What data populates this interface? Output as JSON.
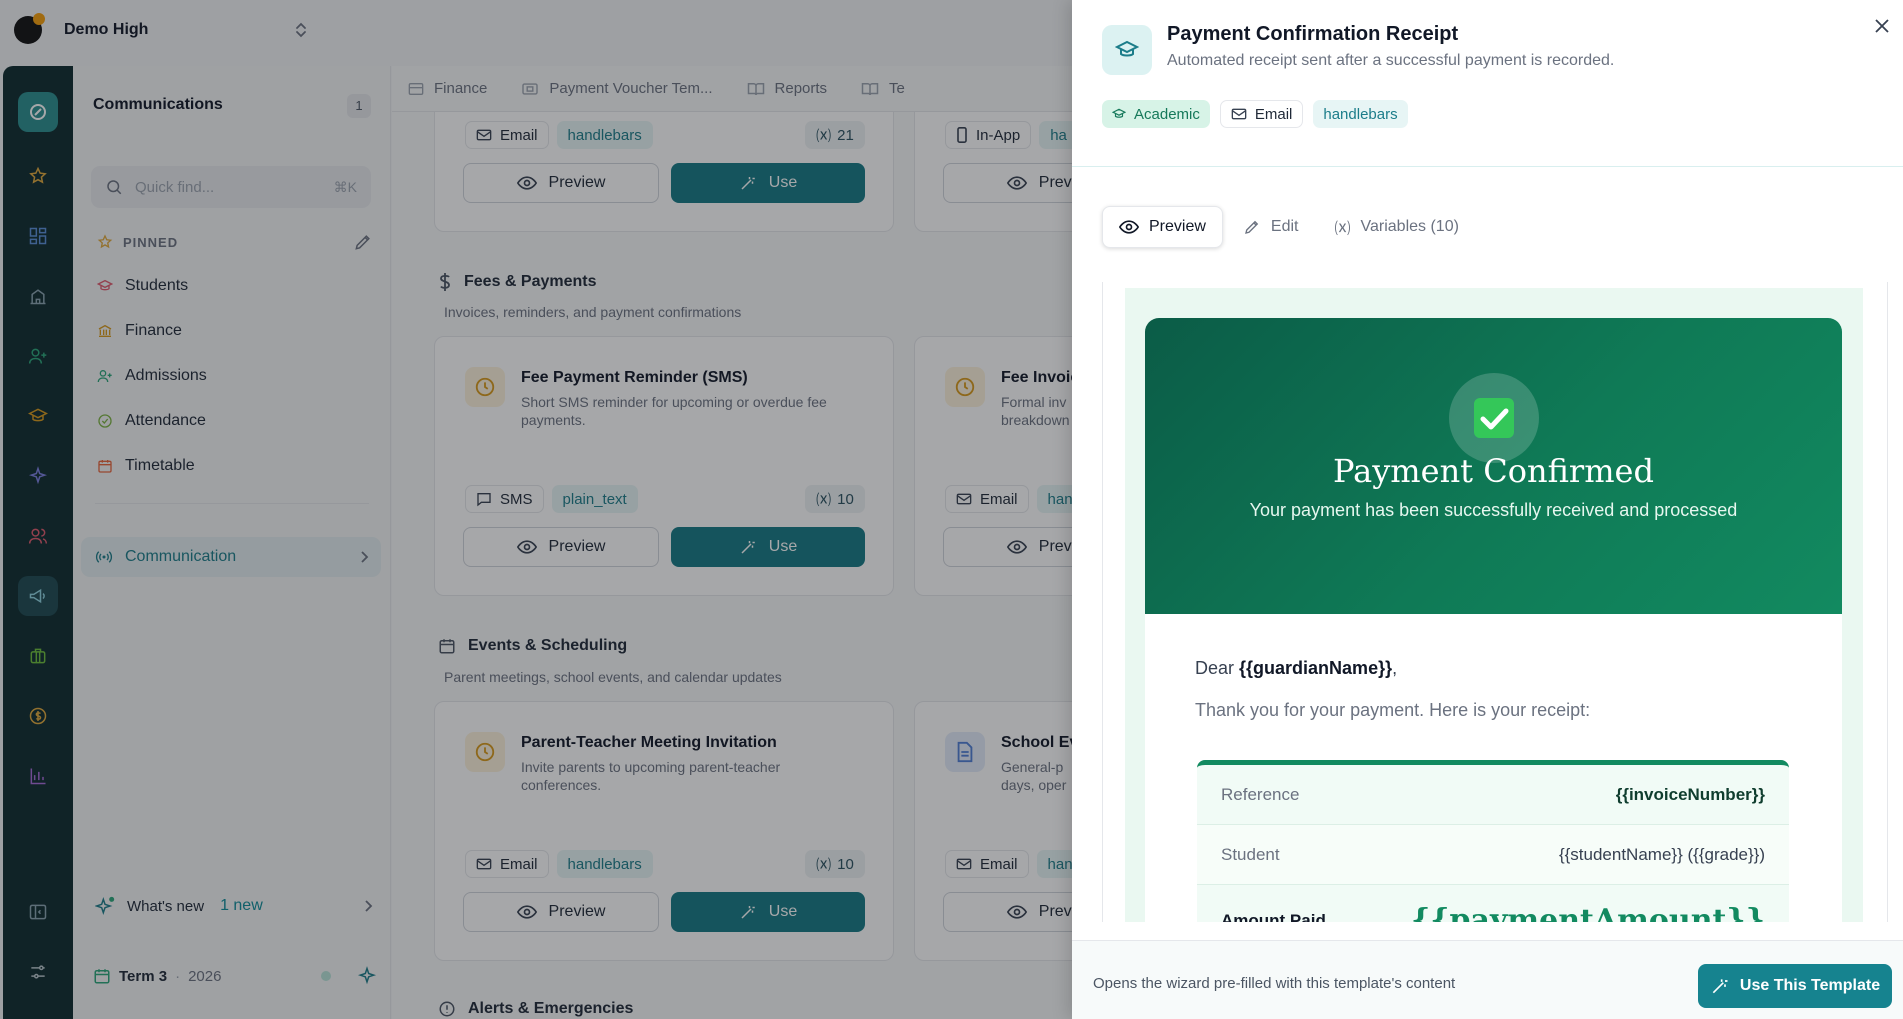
{
  "school": {
    "name": "Demo High"
  },
  "sidebar": {
    "title": "Communications",
    "count": "1",
    "search_placeholder": "Quick find...",
    "search_shortcut": "⌘K",
    "pinned_label": "PINNED",
    "pinned": [
      {
        "label": "Students",
        "icon": "graduation-cap-icon",
        "color": "#e05a6d"
      },
      {
        "label": "Finance",
        "icon": "bank-icon",
        "color": "#d89a1a"
      },
      {
        "label": "Admissions",
        "icon": "user-plus-icon",
        "color": "#2aa67a"
      },
      {
        "label": "Attendance",
        "icon": "check-circle-icon",
        "color": "#7cb342"
      },
      {
        "label": "Timetable",
        "icon": "calendar-icon",
        "color": "#e8663d"
      }
    ],
    "active_item": "Communication",
    "whats_new": {
      "label": "What's new",
      "badge": "1 new"
    },
    "term": {
      "label": "Term 3",
      "year": "2026"
    }
  },
  "tabs": [
    {
      "label": "Finance"
    },
    {
      "label": "Payment Voucher Tem..."
    },
    {
      "label": "Reports"
    },
    {
      "label": "Te"
    }
  ],
  "main": {
    "top_row": {
      "left": {
        "chip1": "Email",
        "chip2": "handlebars",
        "vars": "21"
      },
      "right": {
        "chip1": "In-App",
        "chip2": "ha"
      }
    },
    "preview_label": "Preview",
    "use_label": "Use",
    "preview_short": "Previ",
    "sections": [
      {
        "title": "Fees & Payments",
        "desc": "Invoices, reminders, and payment confirmations",
        "cards": [
          {
            "title": "Fee Payment Reminder (SMS)",
            "desc": "Short SMS reminder for upcoming or overdue fee payments.",
            "chip1": "SMS",
            "chip2": "plain_text",
            "vars": "10"
          },
          {
            "title": "Fee Invoic",
            "desc": "Formal inv breakdown",
            "chip1": "Email",
            "chip2": "han"
          }
        ]
      },
      {
        "title": "Events & Scheduling",
        "desc": "Parent meetings, school events, and calendar updates",
        "cards": [
          {
            "title": "Parent-Teacher Meeting Invitation",
            "desc": "Invite parents to upcoming parent-teacher conferences.",
            "chip1": "Email",
            "chip2": "handlebars",
            "vars": "10"
          },
          {
            "title": "School Ev",
            "desc": "General-p days, oper",
            "chip1": "Email",
            "chip2": "han"
          }
        ]
      },
      {
        "title": "Alerts & Emergencies"
      }
    ]
  },
  "drawer": {
    "title": "Payment Confirmation Receipt",
    "subtitle": "Automated receipt sent after a successful payment is recorded.",
    "tags": [
      "Academic",
      "Email",
      "handlebars"
    ],
    "tabs": {
      "preview": "Preview",
      "edit": "Edit",
      "variables": "Variables (10)"
    },
    "email": {
      "hero_title": "Payment Confirmed",
      "hero_subtitle": "Your payment has been successfully received and processed",
      "dear": "Dear",
      "guardian": "{{guardianName}}",
      "thanks": "Thank you for your payment. Here is your receipt:",
      "rows": [
        {
          "label": "Reference",
          "value": "{{invoiceNumber}}"
        },
        {
          "label": "Student",
          "value": "{{studentName}} ({{grade}})"
        },
        {
          "label": "Amount Paid",
          "value": "{{paymentAmount}}"
        }
      ]
    },
    "footer_note": "Opens the wizard pre-filled with this template's content",
    "use_button": "Use This Template"
  },
  "colors": {
    "accent": "#157a85",
    "rail": "#0d2b2e",
    "success": "#128a60"
  }
}
